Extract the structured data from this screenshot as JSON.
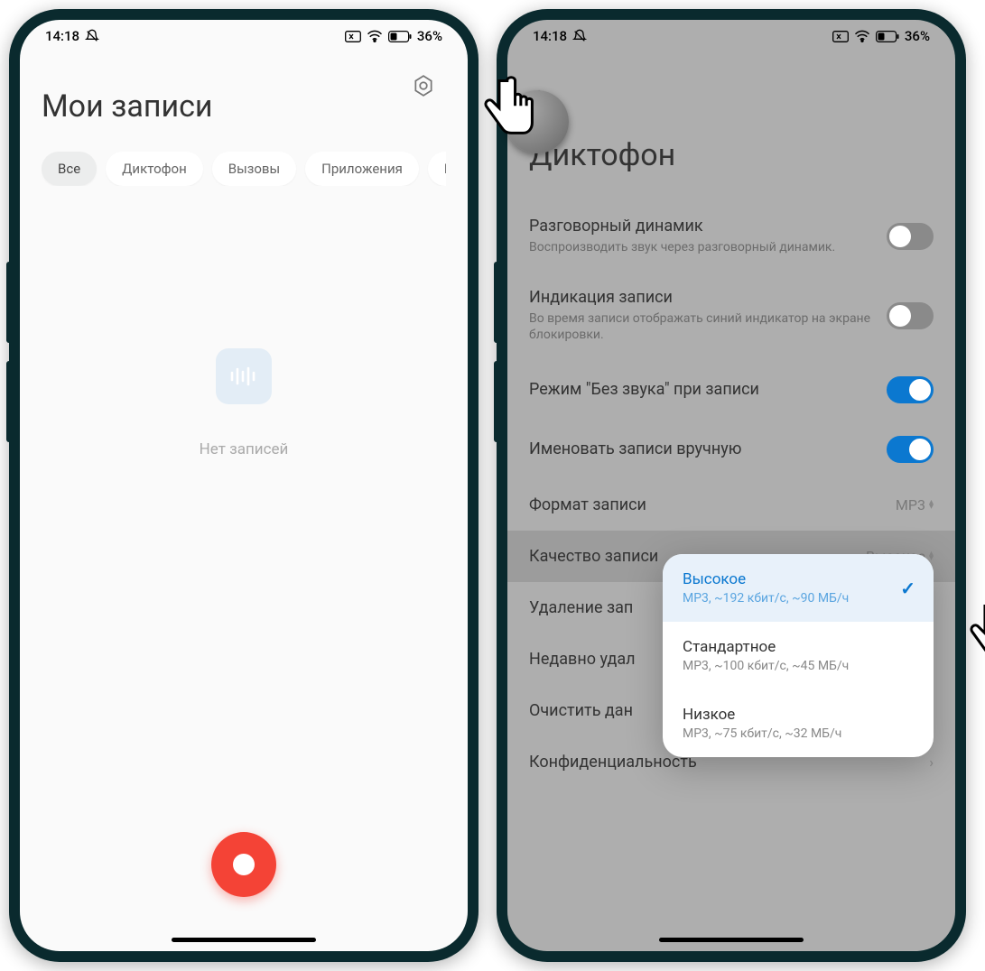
{
  "status": {
    "time": "14:18",
    "battery": "36%"
  },
  "left": {
    "title": "Мои записи",
    "tabs": [
      "Все",
      "Диктофон",
      "Вызовы",
      "Приложения",
      "FM"
    ],
    "empty": "Нет записей"
  },
  "right": {
    "title": "Диктофон",
    "rows": {
      "speaker": {
        "title": "Разговорный динамик",
        "sub": "Воспроизводить звук через разговорный динамик."
      },
      "indicator": {
        "title": "Индикация записи",
        "sub": "Во время записи отображать синий индикатор на экране блокировки."
      },
      "silent": {
        "title": "Режим \"Без звука\" при записи"
      },
      "manual": {
        "title": "Именовать записи вручную"
      },
      "format": {
        "title": "Формат записи",
        "value": "MP3"
      },
      "quality": {
        "title": "Качество записи",
        "value": "Высокое"
      },
      "delete": {
        "title": "Удаление зап"
      },
      "recent": {
        "title": "Недавно удал"
      },
      "clear": {
        "title": "Очистить дан"
      },
      "privacy": {
        "title": "Конфиденциальность"
      }
    },
    "popup": [
      {
        "title": "Высокое",
        "sub": "MP3, ~192 кбит/с, ~90 МБ/ч",
        "selected": true
      },
      {
        "title": "Стандартное",
        "sub": "MP3, ~100 кбит/с, ~45 МБ/ч",
        "selected": false
      },
      {
        "title": "Низкое",
        "sub": "MP3, ~75 кбит/с, ~32 МБ/ч",
        "selected": false
      }
    ]
  }
}
